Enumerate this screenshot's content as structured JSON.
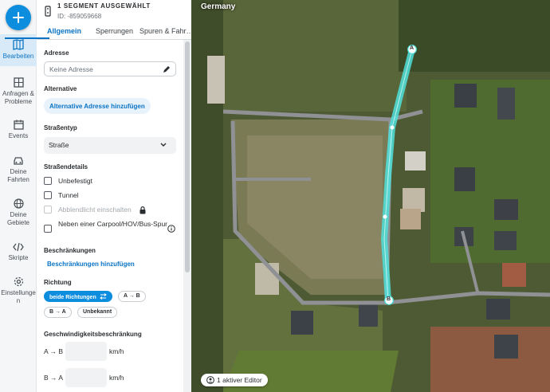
{
  "rail": {
    "items": [
      {
        "label": "Bearbeiten",
        "active": true
      },
      {
        "label": "Anfragen & Probleme"
      },
      {
        "label": "Events"
      },
      {
        "label": "Deine Fahrten"
      },
      {
        "label": "Deine Gebiete"
      },
      {
        "label": "Skripte"
      },
      {
        "label": "Einstellungen"
      }
    ]
  },
  "segment": {
    "title": "1 SEGMENT AUSGEWÄHLT",
    "id": "ID: -859059668"
  },
  "tabs": [
    "Allgemein",
    "Sperrungen",
    "Spuren & Fahr…"
  ],
  "form": {
    "address_label": "Adresse",
    "address_placeholder": "Keine Adresse",
    "alternative_label": "Alternative",
    "alternative_button": "Alternative Adresse hinzufügen",
    "road_type_label": "Straßentyp",
    "road_type_value": "Straße",
    "details_label": "Straßendetails",
    "details": [
      {
        "label": "Unbefestigt",
        "disabled": false
      },
      {
        "label": "Tunnel",
        "disabled": false
      },
      {
        "label": "Abblendlicht einschalten",
        "disabled": true
      },
      {
        "label": "Neben einer Carpool/HOV/Bus-Spur",
        "disabled": false
      }
    ],
    "restrictions_label": "Beschränkungen",
    "restrictions_link": "Beschränkungen hinzufügen",
    "direction_label": "Richtung",
    "direction_options": [
      "beide Richtungen",
      "A → B",
      "B → A",
      "Unbekannt"
    ],
    "direction_selected": "beide Richtungen",
    "speed_label": "Geschwindigkeitsbeschränkung",
    "speed_rows": [
      {
        "label": "A → B",
        "unit": "km/h"
      },
      {
        "label": "B → A",
        "unit": "km/h"
      }
    ]
  },
  "map": {
    "country": "Germany",
    "editors": "1 aktiver Editor",
    "node_a": "A",
    "node_b": "B",
    "segment_color": "#4fe0da"
  },
  "colors": {
    "accent": "#0d8dde",
    "link": "#0b74c4"
  }
}
